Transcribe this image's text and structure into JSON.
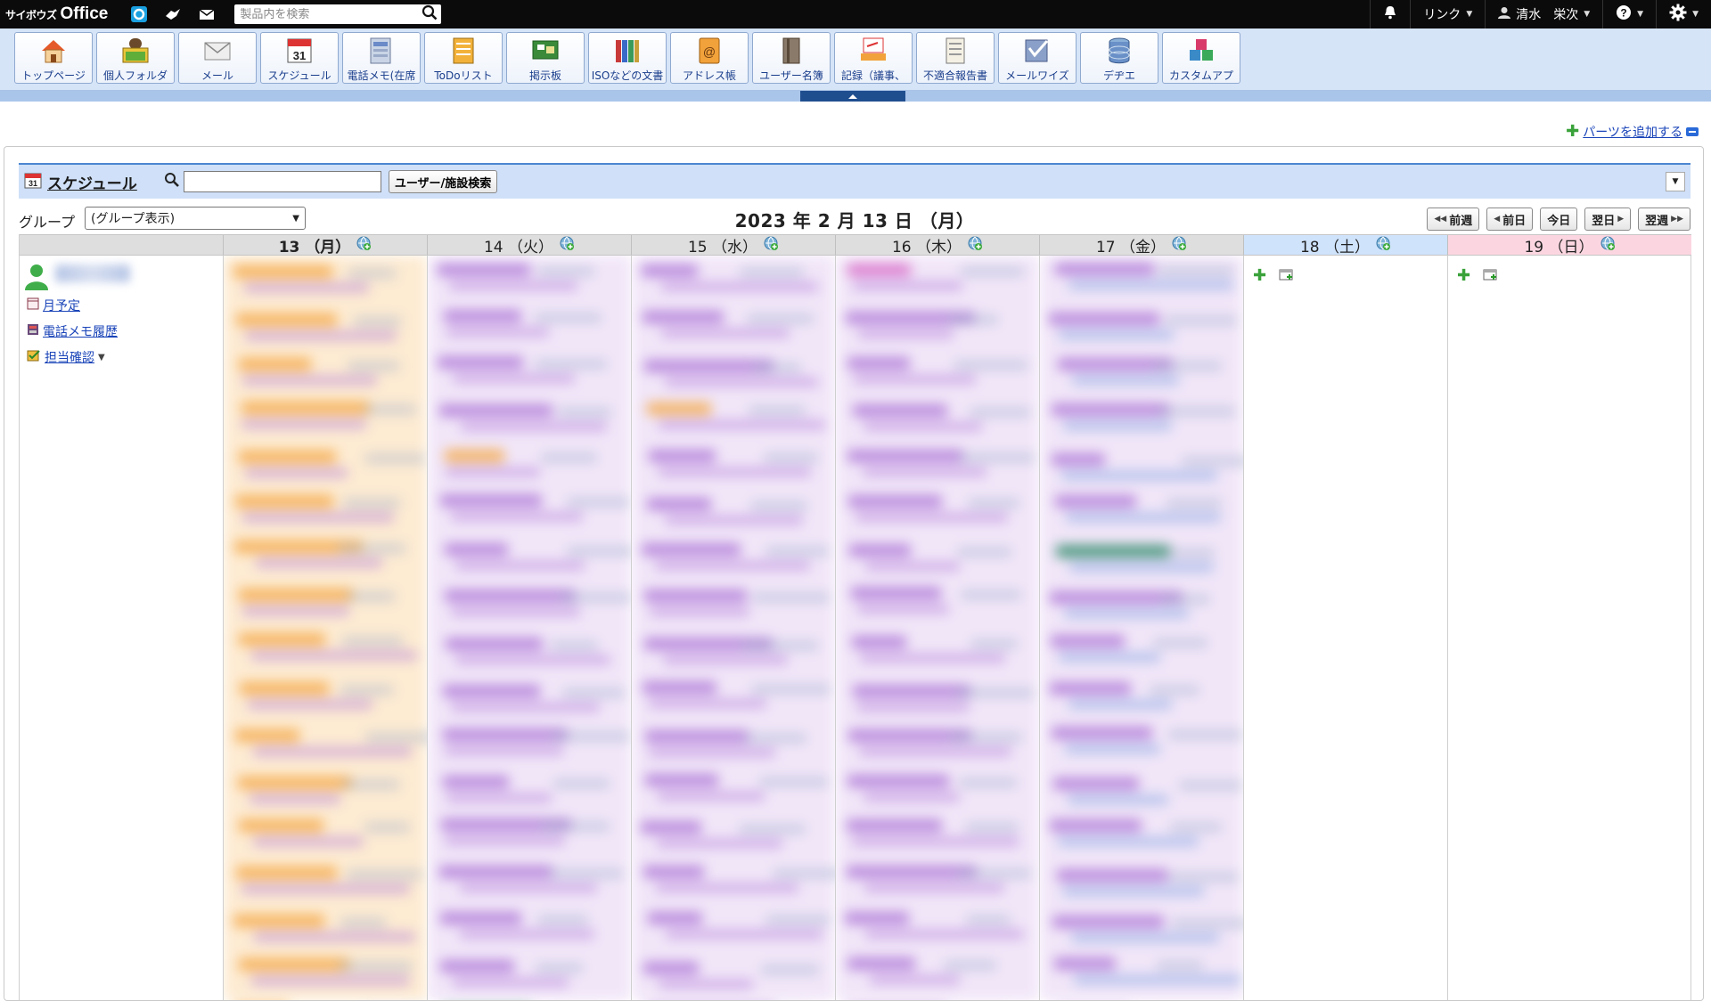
{
  "topbar": {
    "brand_small": "サイボウズ",
    "brand_large": "Office",
    "search_placeholder": "製品内を検索",
    "link_menu": "リンク",
    "user_name": "清水　栄次"
  },
  "apps": [
    {
      "label": "トップページ",
      "icon": "home-icon"
    },
    {
      "label": "個人フォルダ",
      "icon": "folder-icon"
    },
    {
      "label": "メール",
      "icon": "mail-icon"
    },
    {
      "label": "スケジュール",
      "icon": "calendar-icon"
    },
    {
      "label": "電話メモ(在席",
      "icon": "phone-memo-icon"
    },
    {
      "label": "ToDoリスト",
      "icon": "todo-icon"
    },
    {
      "label": "掲示板",
      "icon": "bulletin-icon"
    },
    {
      "label": "ISOなどの文書",
      "icon": "books-icon"
    },
    {
      "label": "アドレス帳",
      "icon": "address-book-icon"
    },
    {
      "label": "ユーザー名簿",
      "icon": "user-list-icon"
    },
    {
      "label": "記録（議事、",
      "icon": "record-icon"
    },
    {
      "label": "不適合報告書",
      "icon": "report-icon"
    },
    {
      "label": "メールワイズ",
      "icon": "mailwise-icon"
    },
    {
      "label": "デヂエ",
      "icon": "database-icon"
    },
    {
      "label": "カスタムアプ",
      "icon": "custom-app-icon"
    }
  ],
  "add_parts_label": "パーツを追加する",
  "schedule": {
    "title": "スケジュール",
    "search_button": "ユーザー/施設検索",
    "group_label": "グループ",
    "group_selected": "(グループ表示)",
    "date_title": "2023 年 2 月 13 日 （月）",
    "nav": {
      "prev_week": "前週",
      "prev_day": "前日",
      "today": "今日",
      "next_day": "翌日",
      "next_week": "翌週"
    },
    "days": [
      {
        "label": "13 （月）",
        "kind": "today"
      },
      {
        "label": "14 （火）",
        "kind": "weekday"
      },
      {
        "label": "15 （水）",
        "kind": "weekday"
      },
      {
        "label": "16 （木）",
        "kind": "weekday"
      },
      {
        "label": "17 （金）",
        "kind": "weekday"
      },
      {
        "label": "18 （土）",
        "kind": "sat"
      },
      {
        "label": "19 （日）",
        "kind": "sun"
      }
    ],
    "user_links": {
      "monthly": "月予定",
      "phone_history": "電話メモ履歴",
      "assignment": "担当確認"
    }
  },
  "colors": {
    "orange_event": "#f4a94a",
    "purple_event": "#b07ad8",
    "blue_event": "#7b9fe0",
    "green_event": "#2e8a6a",
    "today_bg": "#fdebd2",
    "weekday_bg": "#f1e6f8"
  }
}
